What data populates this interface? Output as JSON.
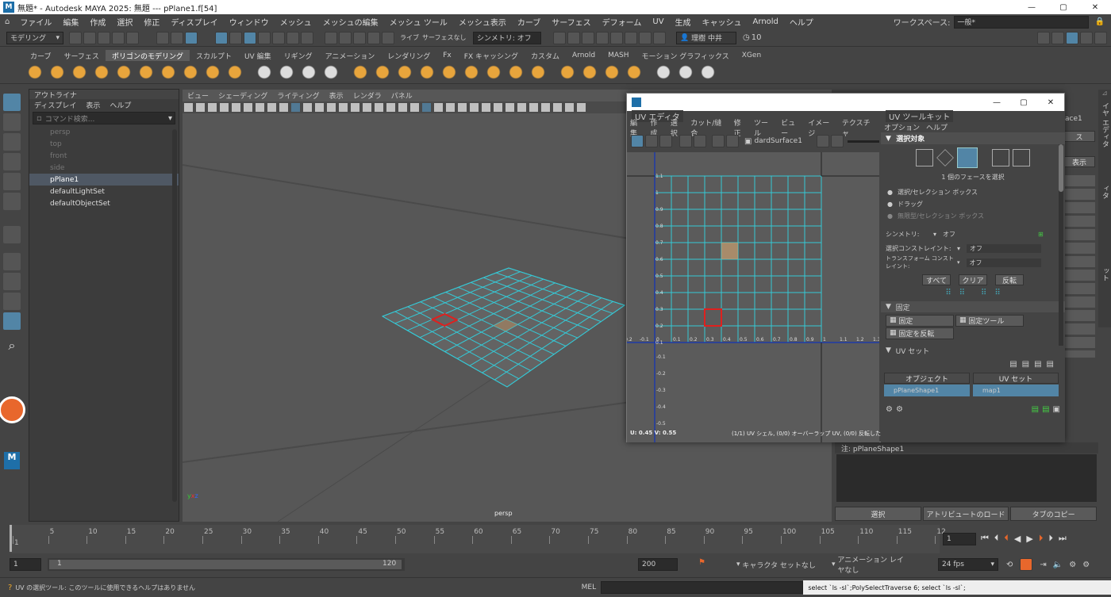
{
  "title": {
    "app": "無題* - Autodesk MAYA 2025: 無題 --- pPlane1.f[54]",
    "workspace_label": "ワークスペース:",
    "workspace_value": "一般*"
  },
  "menubar": {
    "items": [
      "ファイル",
      "編集",
      "作成",
      "選択",
      "修正",
      "ディスプレイ",
      "ウィンドウ",
      "メッシュ",
      "メッシュの編集",
      "メッシュ ツール",
      "メッシュ表示",
      "カーブ",
      "サーフェス",
      "デフォーム",
      "UV",
      "生成",
      "キャッシュ",
      "Arnold",
      "ヘルプ"
    ]
  },
  "statusline": {
    "mode": "モデリング",
    "live": "ライブ",
    "live_value": "サーフェスなし",
    "symmetry": "シンメトリ: オフ",
    "user": "理樹 中井",
    "counter": "10"
  },
  "shelf": {
    "tabs": [
      "カーブ",
      "サーフェス",
      "ポリゴンのモデリング",
      "スカルプト",
      "UV 編集",
      "リギング",
      "アニメーション",
      "レンダリング",
      "Fx",
      "FX キャッシング",
      "カスタム",
      "Arnold",
      "MASH",
      "モーション グラフィックス",
      "XGen"
    ],
    "active_tab": "ポリゴンのモデリング"
  },
  "outliner": {
    "title": "アウトライナ",
    "menu": [
      "ディスプレイ",
      "表示",
      "ヘルプ"
    ],
    "search_placeholder": "コマンド検索...",
    "items": [
      {
        "label": "persp",
        "state": "dim"
      },
      {
        "label": "top",
        "state": "dim"
      },
      {
        "label": "front",
        "state": "dim"
      },
      {
        "label": "side",
        "state": "dim"
      },
      {
        "label": "pPlane1",
        "state": "sel"
      },
      {
        "label": "defaultLightSet",
        "state": "normal"
      },
      {
        "label": "defaultObjectSet",
        "state": "normal"
      }
    ]
  },
  "viewport": {
    "menu": [
      "ビュー",
      "シェーディング",
      "ライティング",
      "表示",
      "レンダラ",
      "パネル"
    ],
    "camera_label": "persp"
  },
  "uv_editor": {
    "title": "UV エディタ",
    "menu": [
      "編集",
      "作成",
      "選択",
      "カット/縫合",
      "修正",
      "ツール",
      "ビュー",
      "イメージ",
      "テクスチャ"
    ],
    "surface": "dardSurface1",
    "status_uv": "U: 0.45 V: 0.55",
    "status_info": "(1/1) UV シェル, (0/0) オーバーラップ UV, (0/0) 反転した UV",
    "ruler_top": [
      "1.1",
      "1",
      "0.9",
      "0.8",
      "0.7",
      "0.6",
      "0.5",
      "0.4",
      "0.3",
      "0.2",
      "0.1"
    ],
    "ruler_bottom": [
      "-0.1",
      "-0.2",
      "-0.3",
      "-0.4",
      "-0.5"
    ],
    "ruler_h": [
      "-0.2",
      "-0.1",
      "0",
      "0.1",
      "0.2",
      "0.3",
      "0.4",
      "0.5",
      "0.6",
      "0.7",
      "0.8",
      "0.9",
      "1",
      "1.1",
      "1.2",
      "1.3"
    ]
  },
  "uv_toolkit": {
    "title": "UV ツールキット",
    "menu": [
      "オプション",
      "ヘルプ"
    ],
    "select_section": "選択対象",
    "face_count": "1 個のフェースを選択",
    "radios": [
      "選択/セレクション ボックス",
      "ドラッグ",
      "無限型/セレクション ボックス"
    ],
    "symmetry_label": "シンメトリ:",
    "symmetry_value": "オフ",
    "constraint_label": "選択コンストレイント:",
    "constraint_value": "オフ",
    "transform_constraint_label": "トランスフォーム コンストレイント:",
    "transform_constraint_value": "オフ",
    "btn_all": "すべて",
    "btn_clear": "クリア",
    "btn_invert": "反転",
    "pin_section": "固定",
    "pin": "固定",
    "pin_tool": "固定ツール",
    "pin_invert": "固定を反転",
    "uvset_section": "UV セット",
    "col_object": "オブジェクト",
    "col_uvset": "UV セット",
    "row_object": "pPlaneShape1",
    "row_uvset": "map1"
  },
  "attr_panel": {
    "note": "注: pPlaneShape1",
    "partial_text": "ace1",
    "partial_btn1": "ス",
    "partial_btn2": "表示",
    "btn_select": "選択",
    "btn_load": "アトリビュートのロード",
    "btn_copy": "タブのコピー",
    "side_tabs": [
      "チャネル ボックス/レイヤ エディタ",
      "アトリビュート エディタ",
      "モデリング ツールキット"
    ]
  },
  "timeline": {
    "ticks": [
      "1",
      "5",
      "10",
      "15",
      "20",
      "25",
      "30",
      "35",
      "40",
      "45",
      "50",
      "55",
      "60",
      "65",
      "70",
      "75",
      "80",
      "85",
      "90",
      "95",
      "100",
      "105",
      "110",
      "115",
      "12"
    ],
    "current": "1"
  },
  "range": {
    "start": "1",
    "inner_start": "1",
    "inner_end": "120",
    "end": "200",
    "character_set": "キャラクタ セットなし",
    "anim_layer": "アニメーション レイヤなし",
    "fps": "24 fps"
  },
  "cmdline": {
    "help": "UV の選択ツール: このツールに使用できるヘルプはありません",
    "lang": "MEL",
    "result": "select `ls -sl`;PolySelectTraverse 6; select `ls -sl`;"
  },
  "colors": {
    "accent_blue": "#5285a6",
    "uv_cyan": "#35c9d6",
    "selection_red": "#e0201e",
    "record_orange": "#e8672c"
  }
}
